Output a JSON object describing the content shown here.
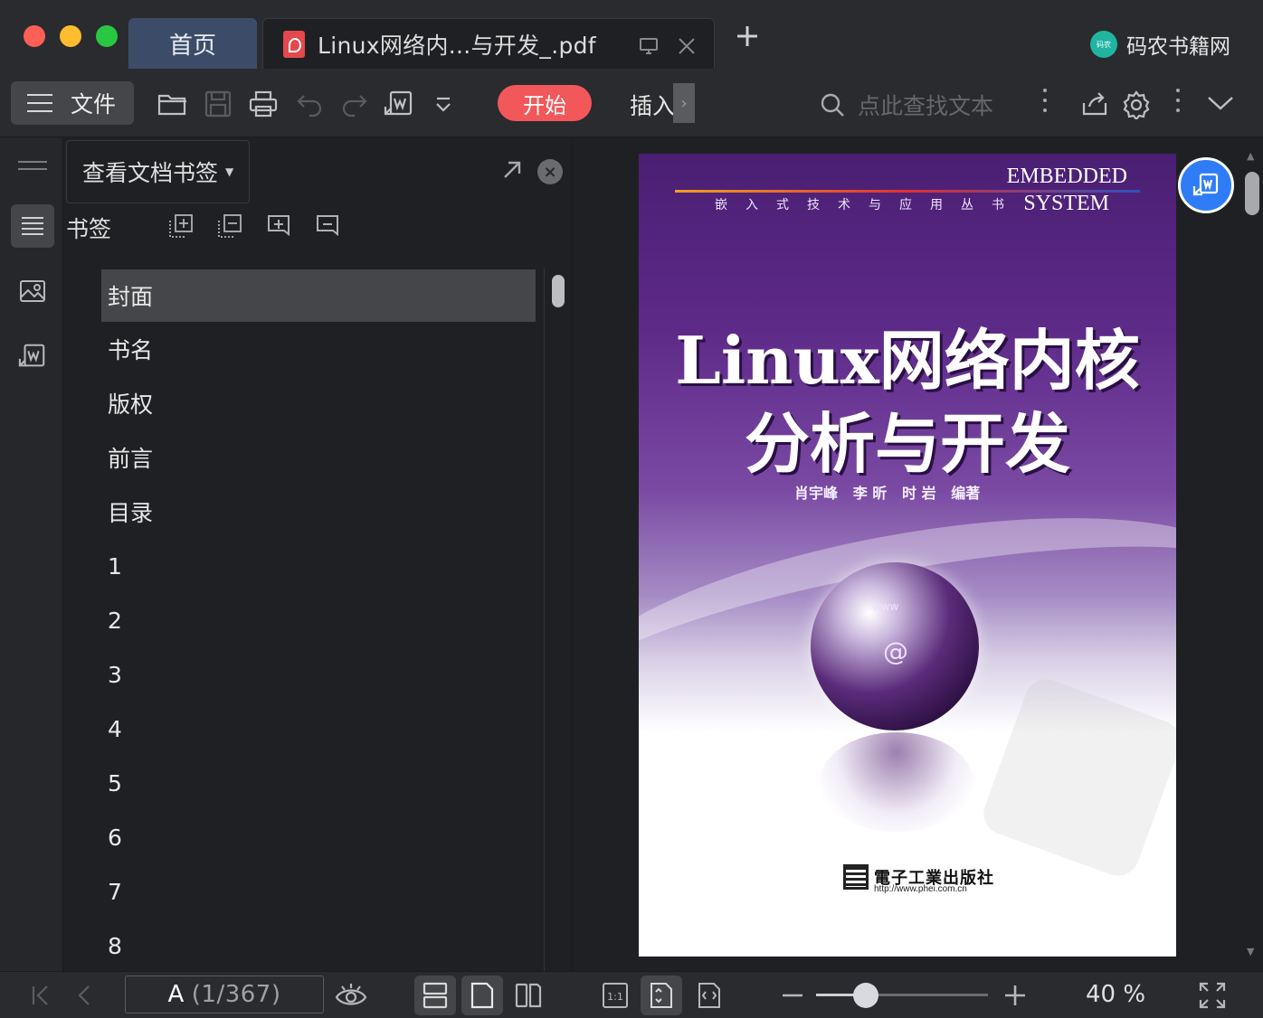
{
  "window": {
    "tabs": [
      {
        "label": "首页"
      },
      {
        "label": "Linux网络内...与开发_.pdf"
      }
    ],
    "brand": "码农书籍网",
    "brand_logo_text": "码农"
  },
  "toolbar": {
    "file_label": "文件",
    "start_label": "开始",
    "insert_label": "插入",
    "search_placeholder": "点此查找文本"
  },
  "bookmarks": {
    "view_select": "查看文档书签",
    "panel_label": "书签",
    "items": [
      "封面",
      "书名",
      "版权",
      "前言",
      "目录",
      "1",
      "2",
      "3",
      "4",
      "5",
      "6",
      "7",
      "8"
    ],
    "selected_index": 0
  },
  "document": {
    "series_cn": "嵌入式技术与应用丛书",
    "series_en_line1": "EMBEDDED",
    "series_en_line2": "SYSTEM",
    "title_line1": "Linux网络内核",
    "title_line2": "分析与开发",
    "authors": "肖宇峰   李 昕   时 岩   编著",
    "globe_www": "www",
    "globe_at": "@",
    "publisher": "電子工業出版社",
    "publisher_url": "http://www.phei.com.cn"
  },
  "status": {
    "current_page_label": "A",
    "page_info": "(1/367)",
    "zoom_percent": 40,
    "zoom_label": "40 %"
  }
}
